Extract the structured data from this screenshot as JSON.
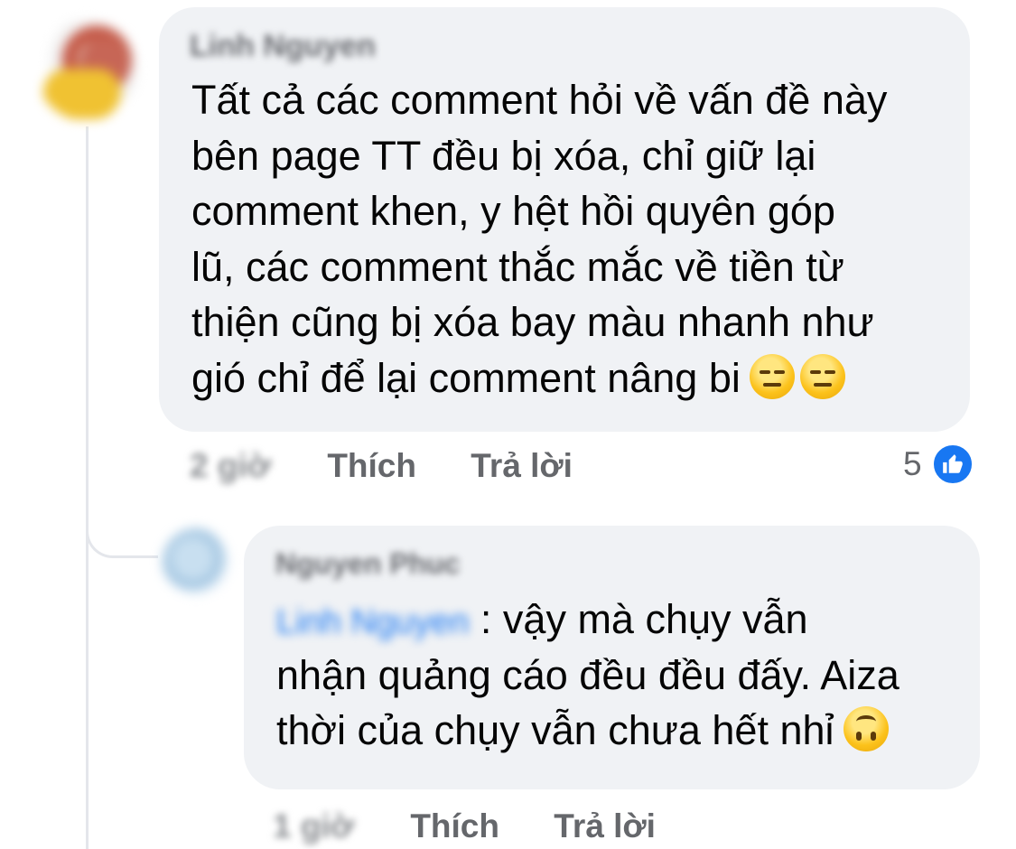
{
  "comments": [
    {
      "author": "Linh Nguyen",
      "lines": [
        "Tất cả các comment hỏi về vấn đề này",
        "bên page TT đều bị xóa, chỉ giữ lại",
        "comment khen, y hệt hồi quyên góp",
        "lũ, các comment thắc mắc về tiền từ",
        "thiện cũng bị xóa bay màu nhanh như",
        "gió chỉ để lại comment nâng bi"
      ],
      "emojis": [
        "expressionless-face",
        "expressionless-face"
      ],
      "timestamp": "2 giờ",
      "like_label": "Thích",
      "reply_label": "Trả lời",
      "reaction_count": "5",
      "reaction_icon": "like-icon"
    },
    {
      "author": "Nguyen Phuc",
      "mention": "Linh Nguyen",
      "lines": [
        ": vậy mà chụy vẫn",
        "nhận quảng cáo đều đều đấy. Aiza",
        "thời của chụy vẫn chưa hết nhỉ"
      ],
      "emojis": [
        "upside-down-face"
      ],
      "timestamp": "1 giờ",
      "like_label": "Thích",
      "reply_label": "Trả lời"
    }
  ],
  "colors": {
    "bubble": "#f0f2f5",
    "text": "#050505",
    "secondary_text": "#65676b",
    "like_blue": "#1877f2",
    "thread_line": "#e4e6eb"
  }
}
